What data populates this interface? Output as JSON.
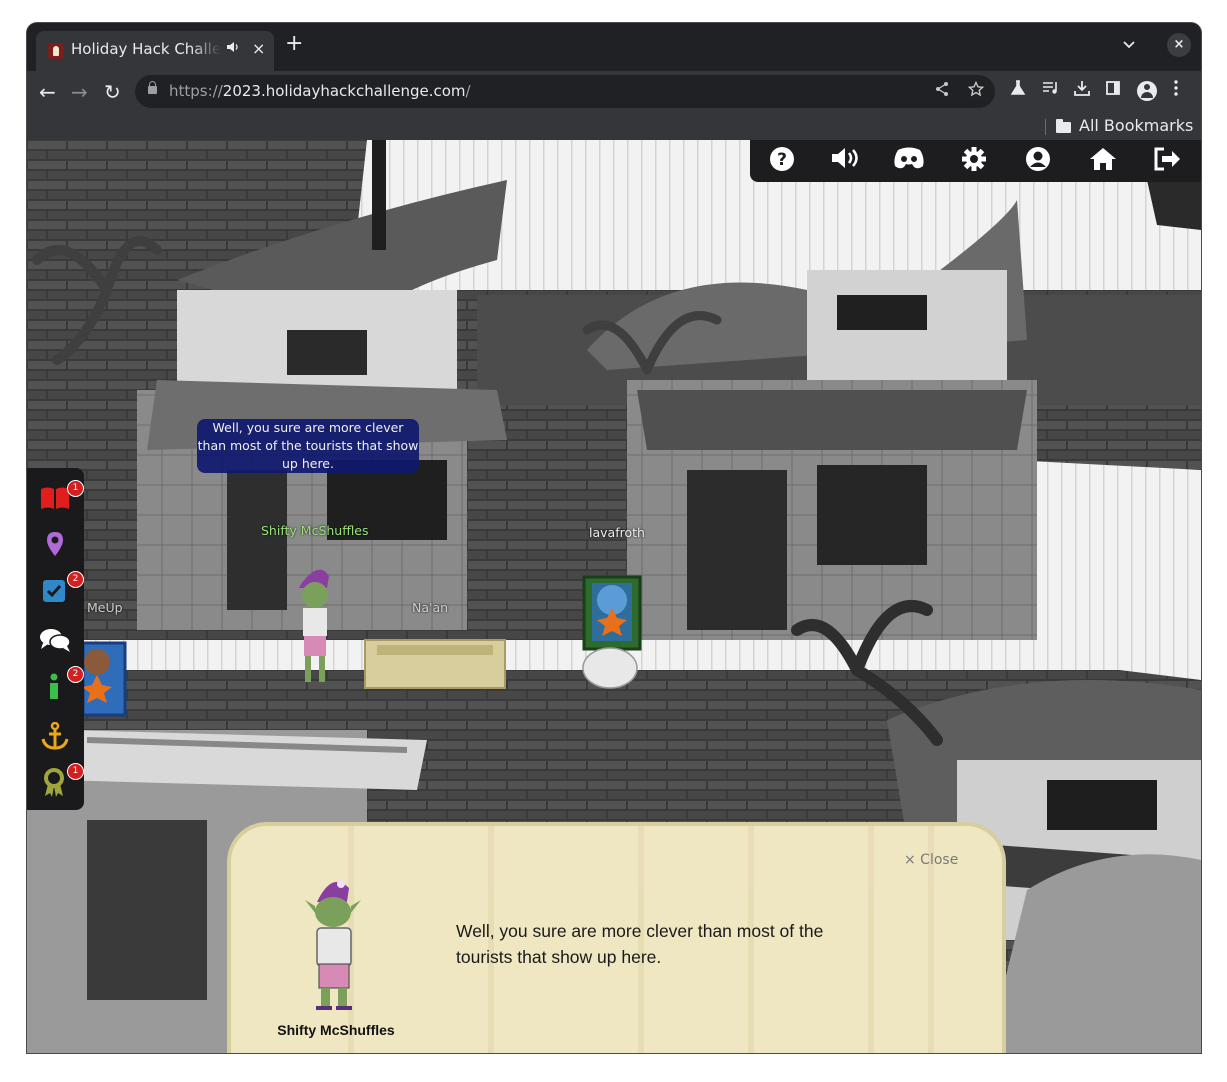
{
  "browser": {
    "tab_title": "Holiday Hack Challenge",
    "url_scheme": "https://",
    "url_host": "2023.holidayhackchallenge.com",
    "url_path": "/",
    "bookmarks_label": "All Bookmarks"
  },
  "icons": {
    "tab_audio": "speaker-icon",
    "new_tab": "+",
    "tab_close": "×",
    "window_close": "×",
    "back": "←",
    "forward": "→",
    "reload": "↻"
  },
  "game": {
    "speech_bubble": "Well, you sure are more clever than most of the tourists that show up here.",
    "player_names": {
      "shifty": "Shifty McShuffles",
      "lavafroth": "lavafroth",
      "naan": "Na'an",
      "meup": "MeUp"
    },
    "topnav_icons": [
      "help-icon",
      "sound-icon",
      "discord-icon",
      "settings-icon",
      "profile-icon",
      "home-icon",
      "logout-icon"
    ],
    "sidebar": {
      "items": [
        {
          "icon": "badge-book-icon",
          "badge": "1"
        },
        {
          "icon": "location-pin-icon",
          "badge": ""
        },
        {
          "icon": "objectives-icon",
          "badge": "2"
        },
        {
          "icon": "chat-icon",
          "badge": ""
        },
        {
          "icon": "info-icon",
          "badge": "2"
        },
        {
          "icon": "anchor-icon",
          "badge": ""
        },
        {
          "icon": "achievement-icon",
          "badge": "1"
        }
      ]
    },
    "dialog": {
      "close_label": "× Close",
      "text": "Well, you sure are more clever than most of the tourists that show up here.",
      "speaker": "Shifty McShuffles"
    }
  },
  "colors": {
    "sidebar_book": "#e01e1e",
    "sidebar_pin": "#b06ad6",
    "sidebar_check": "#2f89c9",
    "sidebar_info": "#3bbf4a",
    "sidebar_anchor": "#e8a81b",
    "sidebar_award": "#9fa53a",
    "shifty_name": "#9be27a"
  }
}
